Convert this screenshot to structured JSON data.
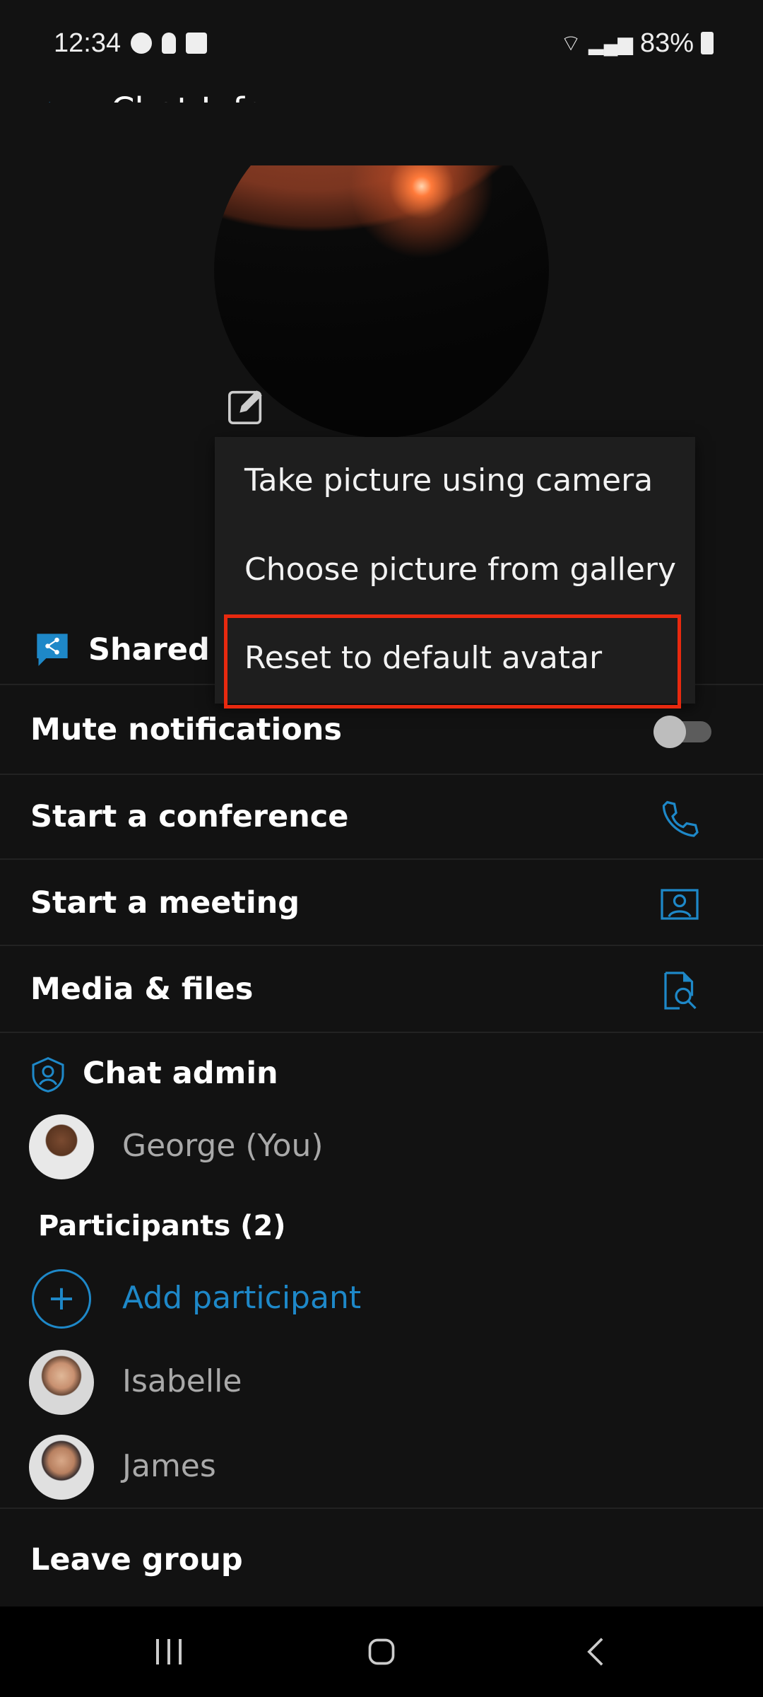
{
  "status_bar": {
    "time": "12:34",
    "battery": "83%",
    "icons": [
      "g-icon",
      "bulb-icon",
      "gallery-icon",
      "wifi-icon",
      "signal-icon",
      "battery-charging-icon"
    ]
  },
  "header": {
    "title": "Chat Info",
    "back_icon": "arrow-left-icon"
  },
  "avatar_menu": {
    "items": [
      "Take picture using camera",
      "Choose picture from gallery",
      "Reset to default avatar"
    ],
    "highlighted": "Reset to default avatar"
  },
  "settings": {
    "shared": "Shared g",
    "mute": "Mute notifications",
    "mute_on": false,
    "conference": "Start a conference",
    "meeting": "Start a meeting",
    "media": "Media & files"
  },
  "admin": {
    "label": "Chat admin",
    "name": "George (You)"
  },
  "participants": {
    "label": "Participants (2)",
    "add": "Add participant",
    "list": [
      "Isabelle",
      "James"
    ]
  },
  "leave": "Leave group",
  "colors": {
    "accent": "#1e88c8",
    "highlight": "#e8290f",
    "background": "#121212"
  }
}
